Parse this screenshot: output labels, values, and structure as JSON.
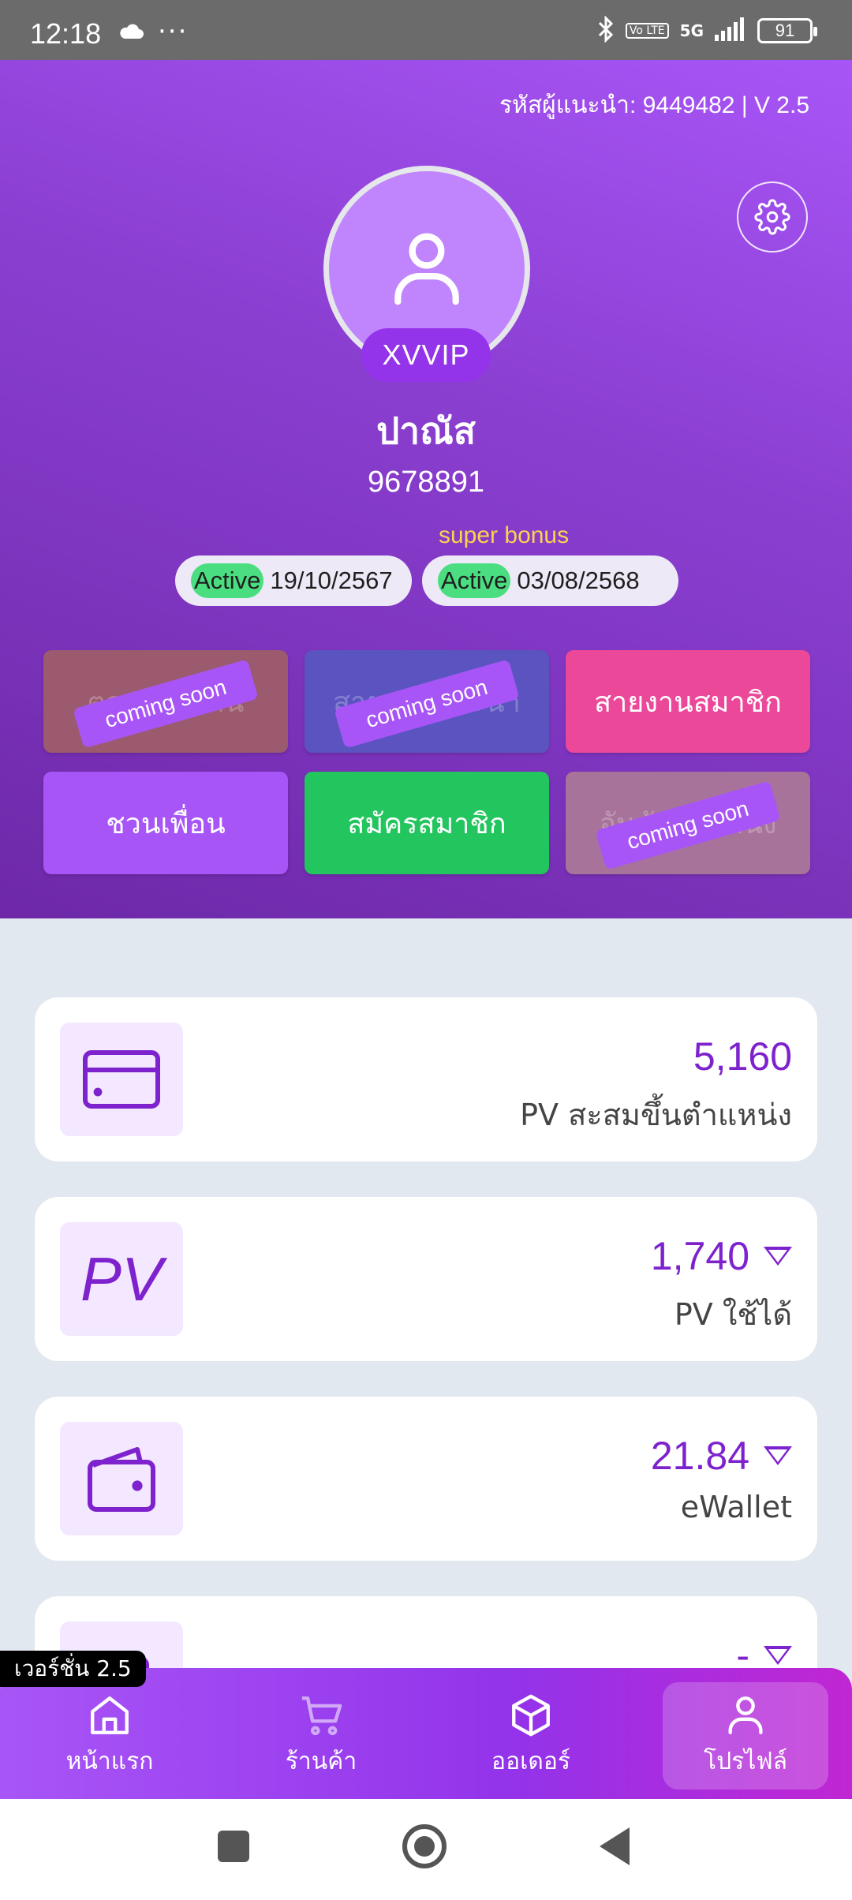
{
  "status_bar": {
    "time": "12:18",
    "network": "5G",
    "volte": "Vo LTE",
    "battery": "91"
  },
  "header": {
    "referrer_line": "รหัสผู้แนะนำ: 9449482 | V 2.5",
    "tier_badge": "XVVIP",
    "user_name": "ปาณัส",
    "user_id": "9678891",
    "super_bonus_label": "super bonus",
    "status_chips": [
      {
        "status": "Active",
        "date": "19/10/2567"
      },
      {
        "status": "Active",
        "date": "03/08/2568"
      }
    ]
  },
  "quick_actions": [
    {
      "label": "ตลาดทีมงาน",
      "color": "#9b5a6e",
      "coming_soon": "coming soon",
      "disabled": true
    },
    {
      "label": "สายงานแนะนำ",
      "color": "#5b54c0",
      "coming_soon": "coming soon",
      "disabled": true
    },
    {
      "label": "สายงานสมาชิก",
      "color": "#ec4899",
      "disabled": false
    },
    {
      "label": "ชวนเพื่อน",
      "color": "#a855f7",
      "disabled": false
    },
    {
      "label": "สมัครสมาชิก",
      "color": "#22c55e",
      "disabled": false
    },
    {
      "label": "อันดับตำแหน่ง",
      "color": "#a8739a",
      "coming_soon": "coming soon",
      "disabled": true
    }
  ],
  "cards": [
    {
      "icon": "card-icon",
      "value": "5,160",
      "label": "PV สะสมขึ้นตำแหน่ง",
      "dropdown": false
    },
    {
      "icon": "pv-icon",
      "icon_text": "PV",
      "value": "1,740",
      "label": "PV ใช้ได้",
      "dropdown": true
    },
    {
      "icon": "wallet-icon",
      "value": "21.84",
      "label": "eWallet",
      "dropdown": true
    },
    {
      "icon": "coin-icon",
      "value": "-",
      "label": "",
      "dropdown": true
    }
  ],
  "version_tag": "เวอร์ชั่น 2.5",
  "bottom_nav": [
    {
      "label": "หน้าแรก",
      "icon": "home-icon"
    },
    {
      "label": "ร้านค้า",
      "icon": "cart-icon"
    },
    {
      "label": "ออเดอร์",
      "icon": "box-icon"
    },
    {
      "label": "โปรไฟล์",
      "icon": "user-icon",
      "active": true
    }
  ]
}
